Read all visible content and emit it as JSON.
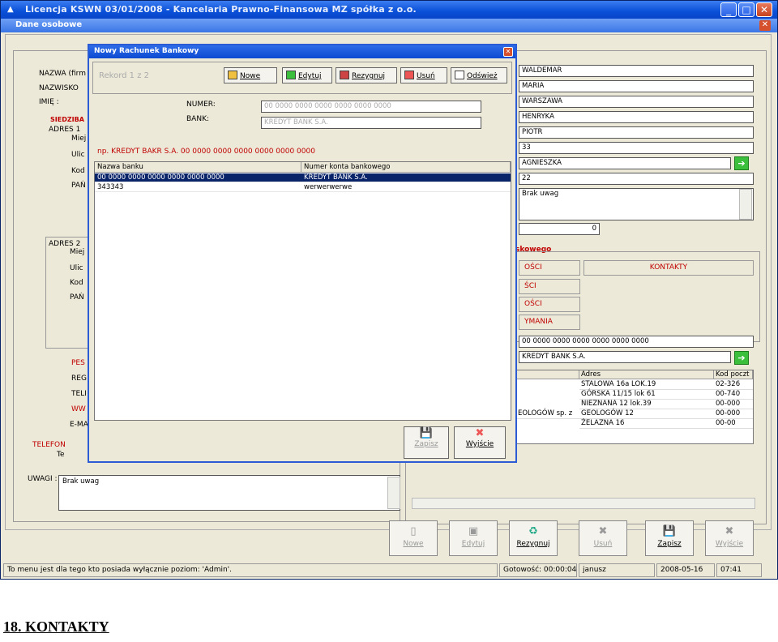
{
  "window": {
    "title": "Licencja KSWN 03/01/2008 - Kancelaria Prawno-Finansowa MZ spółka z o.o.",
    "subtitle": "Dane osobowe"
  },
  "left_panel": {
    "labels": {
      "nazwa": "NAZWA (firm",
      "nazwisko": "NAZWISKO",
      "imie": "IMIĘ :",
      "siedziba": "SIEDZIBA",
      "adres1": "ADRES 1",
      "miejsc1": "Miej",
      "ulica1": "Ulic",
      "kod1": "Kod",
      "panstwo1": "PAŃ",
      "adres2": "ADRES 2",
      "miejsc2": "Miej",
      "ulica2": "Ulic",
      "kod2": "Kod",
      "panstwo2": "PAŃ",
      "pesel": "PES",
      "regon": "REG",
      "tel": "TELI",
      "www": "WW",
      "email": "E-MA",
      "telefony": "TELEFON",
      "tel2": "Te",
      "uwagi": "UWAGI :"
    },
    "uwagi_value": "Brak uwag"
  },
  "right_panel": {
    "fields": [
      "WALDEMAR",
      "MARIA",
      "WARSZAWA",
      "HENRYKA",
      "PIOTR",
      "33",
      "AGNIESZKA",
      "22"
    ],
    "uwagi_value": "Brak uwag",
    "counter": "0",
    "section_title": "skowego",
    "tabs": [
      "OŚCI",
      "KONTAKTY",
      "ŚCI",
      "OŚCI",
      "YMANIA"
    ],
    "account_number": "00 0000 0000 0000 0000 0000 0000",
    "bank_name": "KREDYT BANK S.A.",
    "address_table": {
      "headers": [
        "Adres",
        "Kod poczt"
      ],
      "rows": [
        {
          "name": "",
          "adres": "STALOWA 16a LOK.19",
          "kod": "02-326"
        },
        {
          "name": "",
          "adres": "GÓRSKA 11/15 lok 61",
          "kod": "00-740"
        },
        {
          "name": "",
          "adres": "NIEZNANA 12 lok.39",
          "kod": "00-000"
        },
        {
          "name": "EOLOGÓW sp. z",
          "adres": "GEOLOGÓW 12",
          "kod": "00-000"
        },
        {
          "name": "",
          "adres": "ŻELAZNA 16",
          "kod": "00-00"
        }
      ]
    }
  },
  "dialog": {
    "title": "Nowy Rachunek Bankowy",
    "record": "Rekord 1 z 2",
    "toolbar": {
      "new": "Nowe",
      "edit": "Edytuj",
      "resign": "Rezygnuj",
      "delete": "Usuń",
      "refresh": "Odśwież"
    },
    "numer_label": "NUMER:",
    "numer_value": "00 0000 0000 0000 0000 0000 0000",
    "bank_label": "BANK:",
    "bank_value": "KREDYT BANK S.A.",
    "example": "np.  KREDYT BAKR S.A.   00 0000 0000 0000 0000 0000 0000",
    "grid_headers": [
      "Nazwa banku",
      "Numer konta bankowego"
    ],
    "grid_rows": [
      {
        "name": "00 0000 0000 0000 0000 0000 0000",
        "account": "KREDYT BANK S.A."
      },
      {
        "name": "343343",
        "account": "werwerwerwe"
      }
    ],
    "save": "Zapisz",
    "exit": "Wyjście"
  },
  "bottom_buttons": {
    "new": "Nowe",
    "edit": "Edytuj",
    "resign": "Rezygnuj",
    "delete": "Usuń",
    "save": "Zapisz",
    "exit": "Wyjście"
  },
  "status": {
    "message": "To menu jest dla tego kto posiada wyłącznie poziom: 'Admin'.",
    "ready": "Gotowość: 00:00:04",
    "user": "janusz",
    "date": "2008-05-16",
    "time": "07:41"
  },
  "heading": "18. KONTAKTY"
}
